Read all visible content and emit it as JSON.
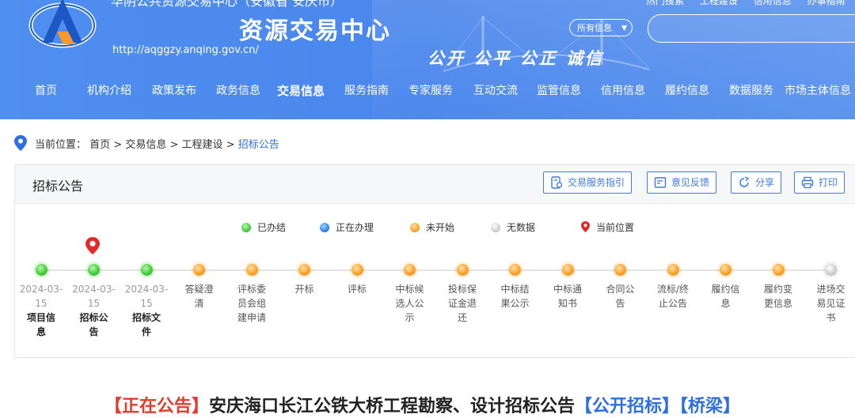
{
  "header": {
    "org_top": "华阴公共资源交易中心（安徽省 安庆市）",
    "title": "资源交易中心",
    "url": "http://aqggzy.anqing.gov.cn/",
    "slogan": "公开 公平 公正 诚信",
    "top_links": [
      "热门搜索",
      "工程建设",
      "信用信息",
      "办事指南"
    ],
    "search_select": "所有信息",
    "search_placeholder": ""
  },
  "nav": {
    "items": [
      "首页",
      "机构介绍",
      "政策发布",
      "政务信息",
      "交易信息",
      "服务指南",
      "专家服务",
      "互动交流",
      "监管信息",
      "信用信息",
      "履约信息",
      "数据服务",
      "市场主体信息"
    ],
    "active": "交易信息"
  },
  "breadcrumb": {
    "label": "当前位置：",
    "items": [
      "首页",
      "交易信息",
      "工程建设",
      "招标公告"
    ],
    "sep": " > "
  },
  "panel": {
    "title": "招标公告",
    "buttons": [
      "交易服务指引",
      "意见反馈",
      "分享",
      "打印"
    ]
  },
  "legend": [
    {
      "label": "已办结",
      "status": "done"
    },
    {
      "label": "正在办理",
      "status": "doing"
    },
    {
      "label": "未开始",
      "status": "pending"
    },
    {
      "label": "无数据",
      "status": "nodata"
    },
    {
      "label": "当前位置",
      "status": "current"
    }
  ],
  "timeline": [
    {
      "date": "2024-03-15",
      "lines": [
        "项目信",
        "息"
      ],
      "status": "done",
      "bold": true
    },
    {
      "date": "2024-03-15",
      "lines": [
        "招标公",
        "告"
      ],
      "status": "done",
      "bold": true,
      "current": true
    },
    {
      "date": "2024-03-15",
      "lines": [
        "招标文",
        "件"
      ],
      "status": "done",
      "bold": true
    },
    {
      "date": "",
      "lines": [
        "答疑澄",
        "清"
      ],
      "status": "pending"
    },
    {
      "date": "",
      "lines": [
        "评标委",
        "员会组",
        "建申请"
      ],
      "status": "pending"
    },
    {
      "date": "",
      "lines": [
        "开标"
      ],
      "status": "pending"
    },
    {
      "date": "",
      "lines": [
        "评标"
      ],
      "status": "pending"
    },
    {
      "date": "",
      "lines": [
        "中标候",
        "选人公",
        "示"
      ],
      "status": "pending"
    },
    {
      "date": "",
      "lines": [
        "投标保",
        "证金退",
        "还"
      ],
      "status": "pending"
    },
    {
      "date": "",
      "lines": [
        "中标结",
        "果公示"
      ],
      "status": "pending"
    },
    {
      "date": "",
      "lines": [
        "中标通",
        "知书"
      ],
      "status": "pending"
    },
    {
      "date": "",
      "lines": [
        "合同公",
        "告"
      ],
      "status": "pending"
    },
    {
      "date": "",
      "lines": [
        "流标/终",
        "止公告"
      ],
      "status": "pending"
    },
    {
      "date": "",
      "lines": [
        "履约信",
        "息"
      ],
      "status": "pending"
    },
    {
      "date": "",
      "lines": [
        "履约变",
        "更信息"
      ],
      "status": "pending"
    },
    {
      "date": "",
      "lines": [
        "进场交",
        "易见证",
        "书"
      ],
      "status": "nodata"
    }
  ],
  "announcement": {
    "status": "【正在公告】",
    "title": "安庆海口长江公铁大桥工程勘察、设计招标公告",
    "tag1": "【公开招标】",
    "tag2": "【桥梁】"
  },
  "colors": {
    "header_blue": "#4f8ff0",
    "link_blue": "#2d6fe0",
    "done": "#46cc3c",
    "doing": "#2e86f0",
    "pending": "#ffa32c",
    "nodata": "#bdbdbd",
    "current": "#e32a2a",
    "alert_red": "#e33b2c"
  }
}
